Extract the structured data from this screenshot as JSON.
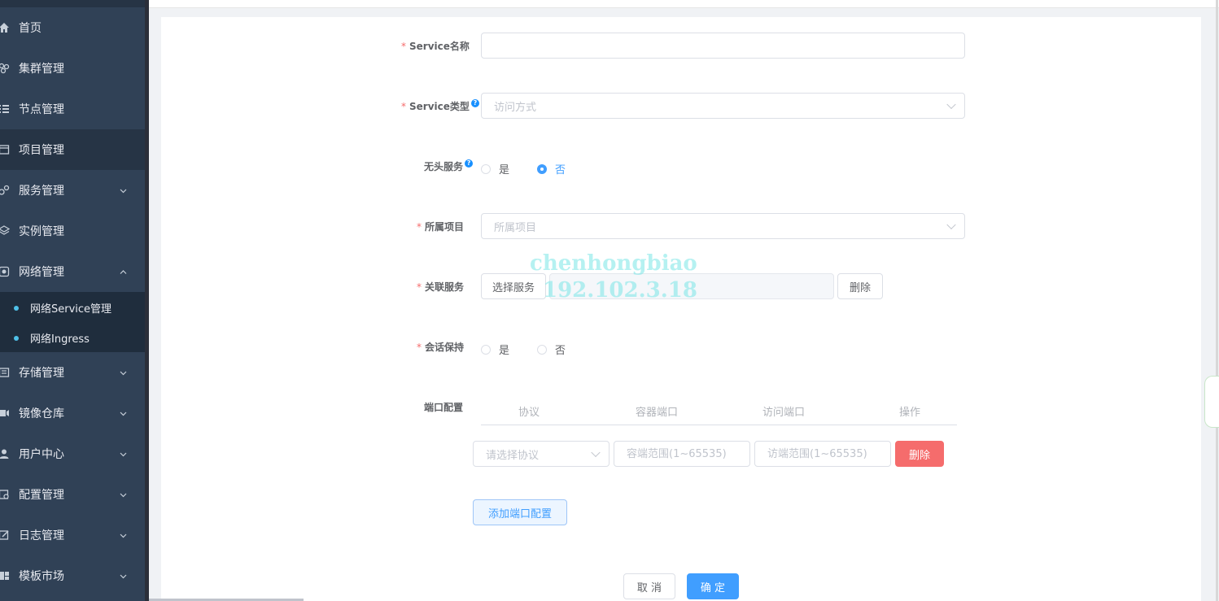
{
  "sidebar": {
    "items": [
      {
        "label": "首页",
        "icon": "home-icon",
        "has_arrow": false
      },
      {
        "label": "集群管理",
        "icon": "cluster-icon",
        "has_arrow": false
      },
      {
        "label": "节点管理",
        "icon": "node-list-icon",
        "has_arrow": false
      },
      {
        "label": "项目管理",
        "icon": "project-icon",
        "has_arrow": false
      },
      {
        "label": "服务管理",
        "icon": "service-icon",
        "has_arrow": true,
        "arrow": "down"
      },
      {
        "label": "实例管理",
        "icon": "layers-icon",
        "has_arrow": false
      },
      {
        "label": "网络管理",
        "icon": "network-icon",
        "has_arrow": true,
        "arrow": "up"
      },
      {
        "label": "存储管理",
        "icon": "storage-icon",
        "has_arrow": true,
        "arrow": "down"
      },
      {
        "label": "镜像仓库",
        "icon": "image-repo-icon",
        "has_arrow": true,
        "arrow": "down"
      },
      {
        "label": "用户中心",
        "icon": "user-icon",
        "has_arrow": true,
        "arrow": "down"
      },
      {
        "label": "配置管理",
        "icon": "config-icon",
        "has_arrow": true,
        "arrow": "down"
      },
      {
        "label": "日志管理",
        "icon": "log-icon",
        "has_arrow": true,
        "arrow": "down"
      },
      {
        "label": "模板市场",
        "icon": "template-icon",
        "has_arrow": true,
        "arrow": "down"
      }
    ],
    "network_submenu": [
      "网络Service管理",
      "网络Ingress"
    ]
  },
  "form": {
    "service_name": {
      "label": "Service名称",
      "value": ""
    },
    "service_type": {
      "label": "Service类型",
      "placeholder": "访问方式"
    },
    "headless": {
      "label": "无头服务",
      "options": [
        "是",
        "否"
      ],
      "selected": "否"
    },
    "project": {
      "label": "所属项目",
      "placeholder": "所属项目"
    },
    "related_service": {
      "label": "关联服务",
      "select_button": "选择服务",
      "delete_button": "删除"
    },
    "session_affinity": {
      "label": "会话保持",
      "options": [
        "是",
        "否"
      ],
      "selected": ""
    },
    "port_config": {
      "label": "端口配置",
      "columns": [
        "协议",
        "容器端口",
        "访问端口",
        "操作"
      ],
      "row": {
        "protocol_placeholder": "请选择协议",
        "container_port_placeholder": "容端范围(1~65535)",
        "access_port_placeholder": "访端范围(1~65535)",
        "delete_button": "删除"
      },
      "add_button": "添加端口配置"
    },
    "cancel_button": "取 消",
    "confirm_button": "确 定"
  },
  "watermark": {
    "line1": "chenhongbiao",
    "line2": "192.102.3.18"
  },
  "colors": {
    "sidebar_bg": "#304156",
    "sidebar_active": "#263445",
    "primary": "#409eff",
    "danger": "#f56c6c"
  }
}
